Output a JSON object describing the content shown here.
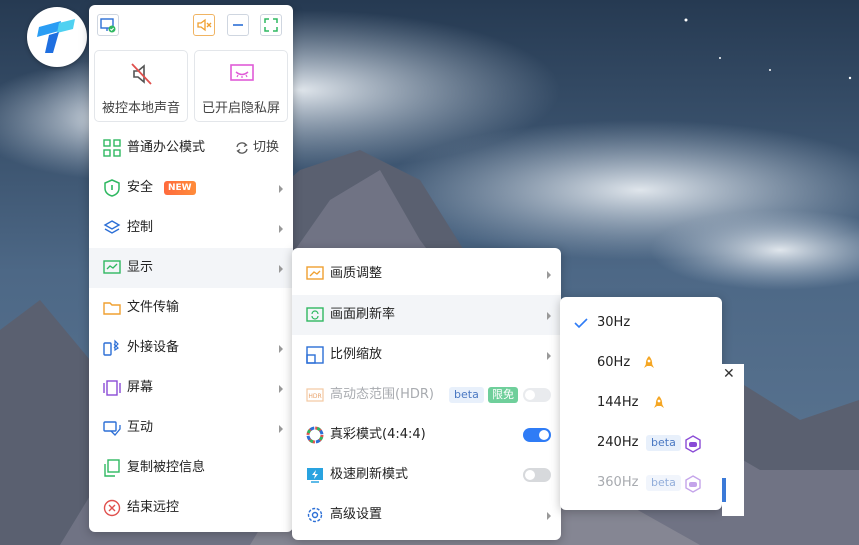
{
  "topbar": {
    "monitor_icon": "monitor-check-icon",
    "mute_icon": "speaker-mute-icon",
    "minimize_icon": "minimize-icon",
    "fullscreen_icon": "fullscreen-icon"
  },
  "tiles": [
    {
      "label": "被控本地声音",
      "icon": "speaker-off-icon"
    },
    {
      "label": "已开启隐私屏",
      "icon": "privacy-screen-icon"
    }
  ],
  "menu": {
    "items": [
      {
        "label": "普通办公模式",
        "action": "切换"
      },
      {
        "label": "安全",
        "badge": "NEW"
      },
      {
        "label": "控制"
      },
      {
        "label": "显示"
      },
      {
        "label": "文件传输"
      },
      {
        "label": "外接设备"
      },
      {
        "label": "屏幕"
      },
      {
        "label": "互动"
      },
      {
        "label": "复制被控信息"
      },
      {
        "label": "结束远控"
      }
    ]
  },
  "display_menu": {
    "items": [
      {
        "label": "画质调整"
      },
      {
        "label": "画面刷新率"
      },
      {
        "label": "比例缩放"
      },
      {
        "label": "高动态范围(HDR)",
        "beta": "beta",
        "tag": "限免",
        "toggle": false,
        "disabled": true
      },
      {
        "label": "真彩模式(4:4:4)",
        "toggle": true
      },
      {
        "label": "极速刷新模式",
        "toggle": false
      },
      {
        "label": "高级设置"
      }
    ]
  },
  "refresh_menu": {
    "items": [
      {
        "label": "30Hz",
        "checked": true
      },
      {
        "label": "60Hz",
        "icon": "rocket-icon"
      },
      {
        "label": "144Hz",
        "icon": "rocket-icon"
      },
      {
        "label": "240Hz",
        "beta": "beta",
        "icon": "gamepad-icon"
      },
      {
        "label": "360Hz",
        "beta": "beta",
        "icon": "gamepad-icon",
        "disabled": true
      }
    ]
  },
  "colors": {
    "accent": "#2f7cf6",
    "rocket": "#f5a623",
    "gamepad": "#8a4bd6",
    "new_badge": "#ff6a3d"
  }
}
